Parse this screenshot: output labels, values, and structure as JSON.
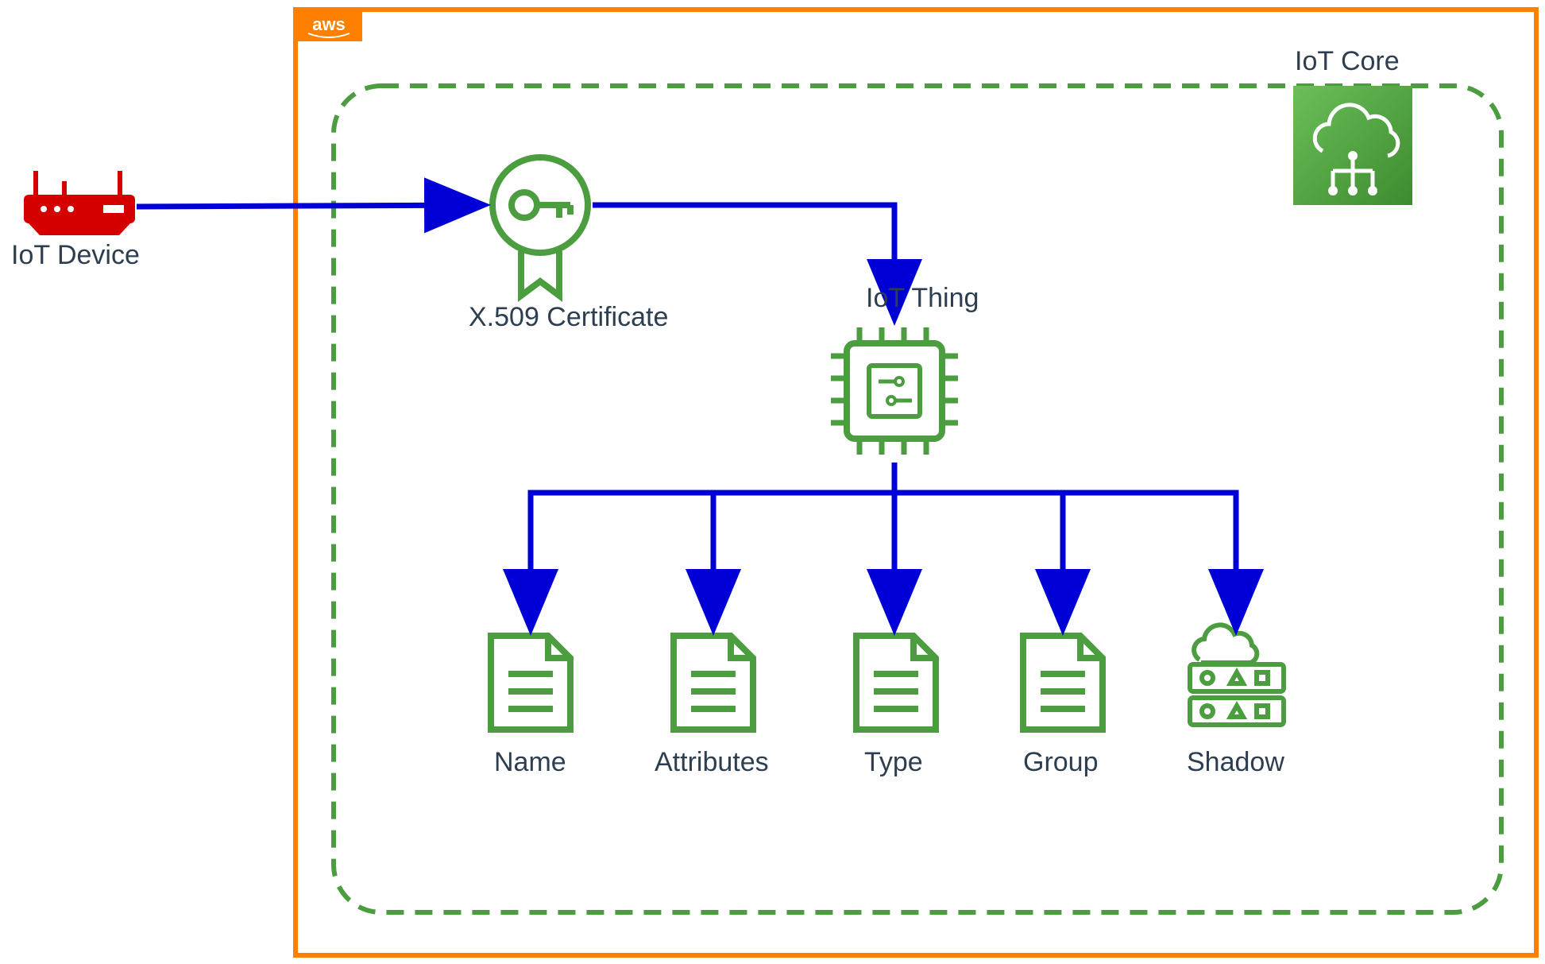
{
  "diagram": {
    "device_label": "IoT Device",
    "aws_badge": "aws",
    "cert_label": "X.509 Certificate",
    "iot_thing_label": "IoT Thing",
    "iot_core_label": "IoT Core",
    "props": {
      "name": "Name",
      "attributes": "Attributes",
      "type": "Type",
      "group": "Group",
      "shadow": "Shadow"
    }
  },
  "colors": {
    "aws_orange": "#FF8000",
    "iot_green": "#4B9D40",
    "iot_green_dark": "#3D8B2F",
    "arrow_blue": "#0000D6",
    "device_red": "#D40000",
    "text": "#2c3e50"
  }
}
